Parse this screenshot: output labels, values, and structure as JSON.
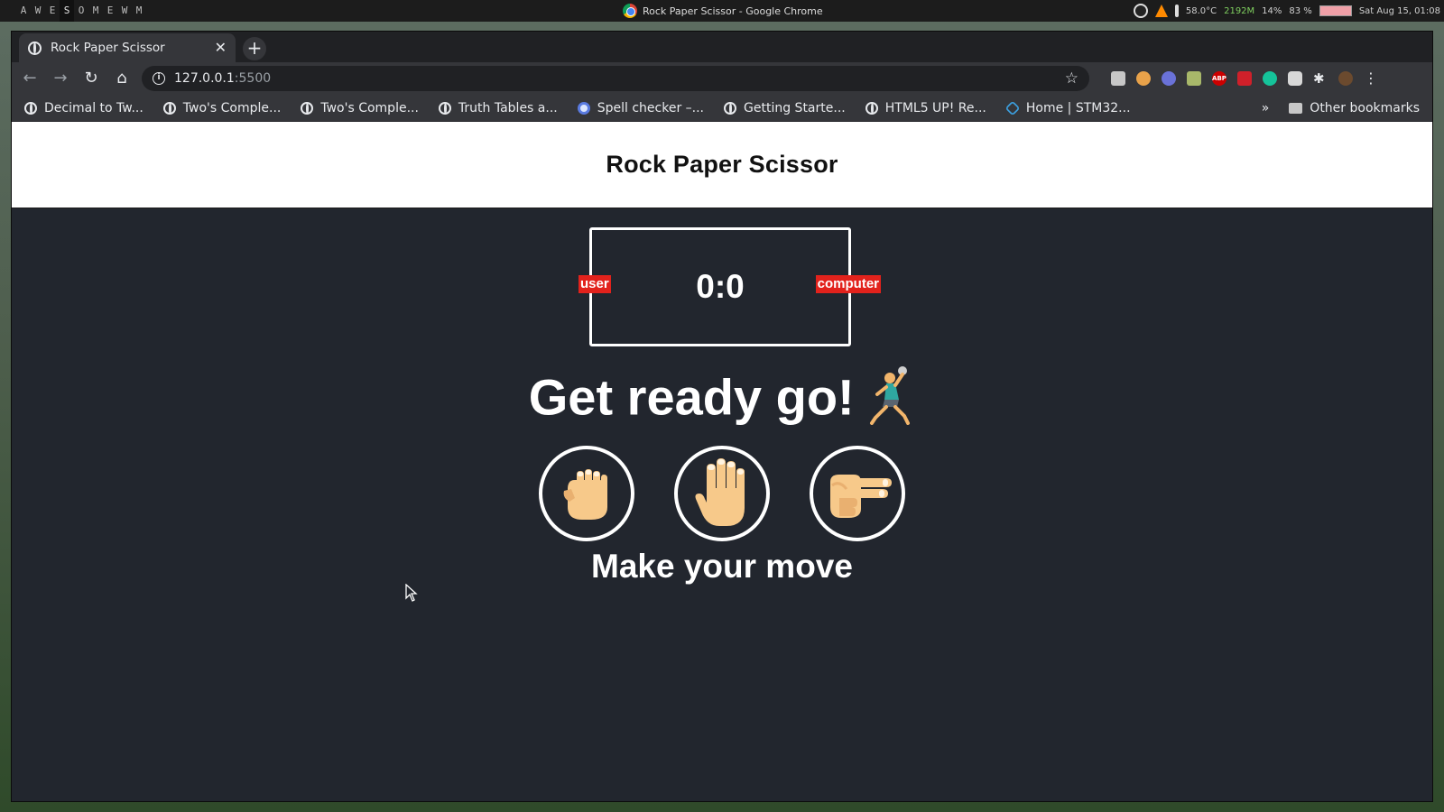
{
  "system_bar": {
    "tags": [
      "",
      "A",
      "W",
      "E",
      "S",
      "O",
      "M",
      "E",
      "W",
      "M"
    ],
    "window_title": "Rock Paper Scissor - Google Chrome",
    "temperature": "58.0°C",
    "memory": "2192M",
    "cpu": "14%",
    "battery": "83 %",
    "datetime": "Sat Aug 15, 01:08"
  },
  "browser": {
    "tab_title": "Rock Paper Scissor",
    "url_host": "127.0.0.1",
    "url_port": ":5500",
    "bookmarks": [
      {
        "label": "Decimal to Tw...",
        "icon": "globe-icon"
      },
      {
        "label": "Two's Comple...",
        "icon": "globe-icon"
      },
      {
        "label": "Two's Comple...",
        "icon": "globe-icon"
      },
      {
        "label": "Truth Tables a...",
        "icon": "globe-icon"
      },
      {
        "label": "Spell checker –...",
        "icon": "spell-icon"
      },
      {
        "label": "Getting Starte...",
        "icon": "globe-icon"
      },
      {
        "label": "HTML5 UP! Re...",
        "icon": "globe-icon"
      },
      {
        "label": "Home | STM32...",
        "icon": "hexagon-icon"
      }
    ],
    "other_bookmarks": "Other bookmarks",
    "more_bookmarks": "»"
  },
  "page": {
    "title": "Rock Paper Scissor",
    "score": "0:0",
    "user_label": "user",
    "computer_label": "computer",
    "message": "Get ready go!",
    "message_emoji": "person-playing-handball",
    "choices": [
      {
        "name": "rock",
        "icon": "raised-fist-hand-icon"
      },
      {
        "name": "paper",
        "icon": "raised-hand-icon"
      },
      {
        "name": "scissors",
        "icon": "victory-hand-icon"
      }
    ],
    "prompt": "Make your move"
  },
  "colors": {
    "page_bg": "#22262e",
    "header_bg": "#ffffff",
    "badge_red": "#e2221c",
    "skin": "#f7c98a"
  }
}
